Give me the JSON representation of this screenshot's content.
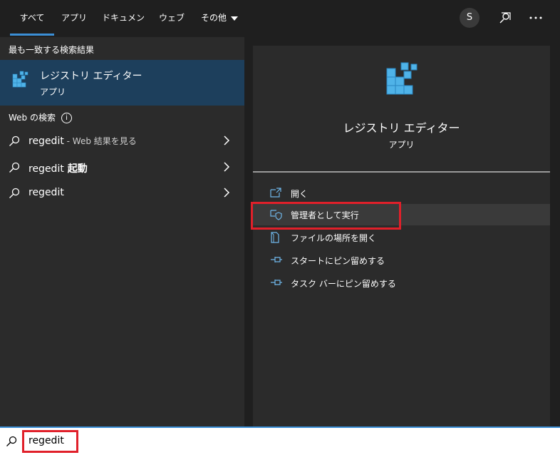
{
  "tabs": [
    {
      "label": "すべて",
      "active": true
    },
    {
      "label": "アプリ"
    },
    {
      "label": "ドキュメント"
    },
    {
      "label": "ウェブ"
    },
    {
      "label": "その他"
    }
  ],
  "header": {
    "avatar_initial": "S",
    "feedback_icon": "feedback-icon",
    "more_icon": "more-icon"
  },
  "left": {
    "best_match_header": "最も一致する検索結果",
    "best_match": {
      "title": "レジストリ エディター",
      "subtitle": "アプリ"
    },
    "web_header": "Web の検索",
    "web_items": [
      {
        "text": "regedit",
        "suffix": " - Web 結果を見る"
      },
      {
        "text": "regedit",
        "bold": " 起動"
      },
      {
        "text": "regedit"
      }
    ]
  },
  "right": {
    "title": "レジストリ エディター",
    "subtitle": "アプリ",
    "actions": [
      {
        "label": "開く",
        "icon": "open-icon"
      },
      {
        "label": "管理者として実行",
        "icon": "shield-icon"
      },
      {
        "label": "ファイルの場所を開く",
        "icon": "file-location-icon"
      },
      {
        "label": "スタートにピン留めする",
        "icon": "pin-icon"
      },
      {
        "label": "タスク バーにピン留めする",
        "icon": "pin-icon"
      }
    ]
  },
  "search": {
    "value": "regedit"
  },
  "colors": {
    "accent": "#3b8fd6",
    "highlight_box": "#e0202a",
    "selected_bg": "#1d3f5c"
  }
}
